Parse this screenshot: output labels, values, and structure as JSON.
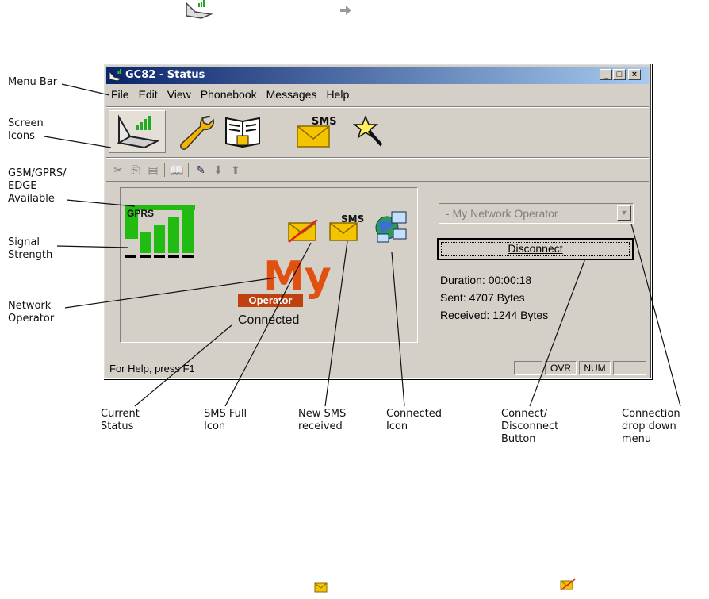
{
  "window": {
    "title": "GC82 - Status",
    "menu": [
      "File",
      "Edit",
      "View",
      "Phonebook",
      "Messages",
      "Help"
    ],
    "network_operator_select": "- My Network Operator",
    "disconnect_label": "Disconnect",
    "duration": "Duration: 00:00:18",
    "sent": "Sent: 4707 Bytes",
    "received": "Received: 1244 Bytes",
    "gprs_label": "GPRS",
    "sms_label": "SMS",
    "operator_logo_letters": "My",
    "operator_logo_word": "Operator",
    "connection_status": "Connected",
    "status_help": "For Help, press F1",
    "status_indicators": [
      "OVR",
      "NUM"
    ],
    "window_buttons": [
      "_",
      "□",
      "×"
    ],
    "signal_strength_bars": 5
  },
  "annotations": {
    "menu_bar": "Menu Bar",
    "screen_icons": "Screen\nIcons",
    "gsm_available": "GSM/GPRS/\nEDGE\nAvailable",
    "signal_strength": "Signal\nStrength",
    "network_operator": "Network\nOperator",
    "current_status": "Current\nStatus",
    "sms_full": "SMS Full\nIcon",
    "new_sms": "New SMS\nreceived",
    "connected_icon": "Connected\nIcon",
    "connect_button": "Connect/\nDisconnect\nButton",
    "connection_dropdown": "Connection\ndrop down\nmenu"
  },
  "colors": {
    "titlebar_start": "#0a246a",
    "titlebar_end": "#a6caf0",
    "signal_green": "#22bb11",
    "sms_envelope": "#f5c400",
    "full_cross": "#e02020",
    "logo_orange": "#e05010"
  }
}
